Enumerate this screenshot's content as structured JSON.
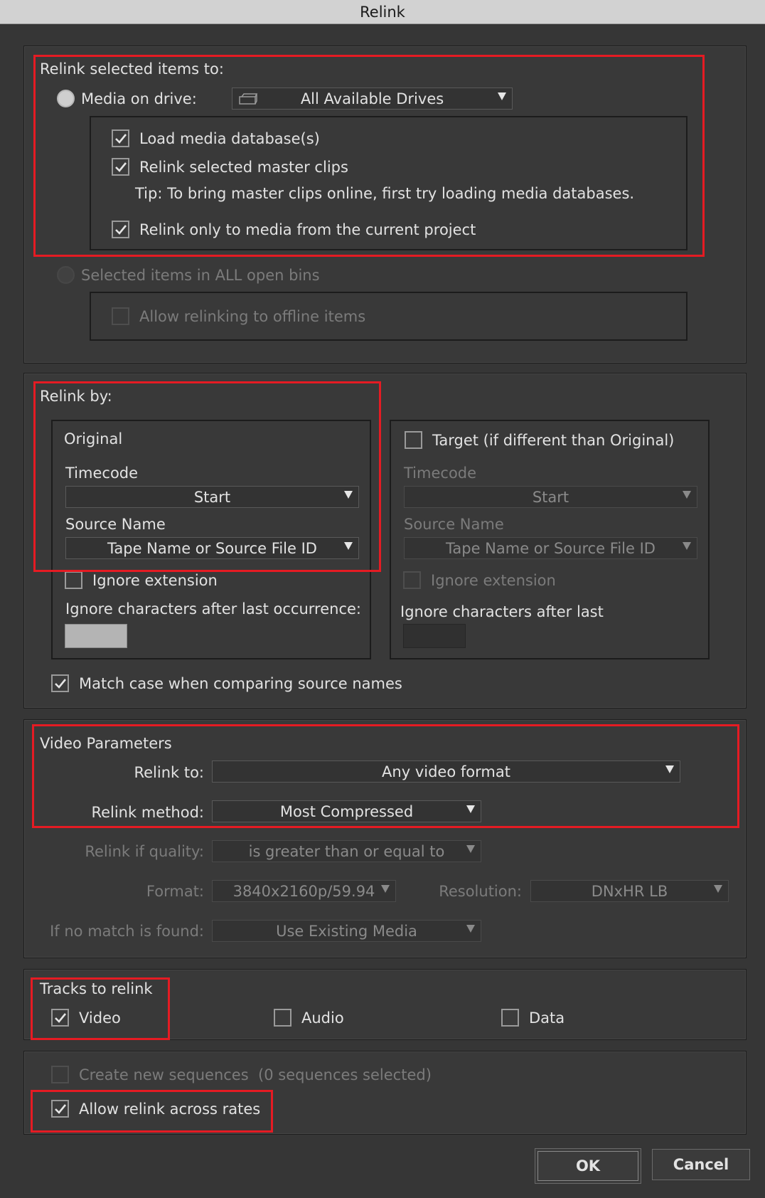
{
  "window": {
    "title": "Relink"
  },
  "relink_items": {
    "label": "Relink selected items to:",
    "media_on_drive_label": "Media on drive:",
    "drive_dropdown": {
      "value": "All Available Drives",
      "icon": "drive-icon"
    },
    "load_media_db": {
      "label": "Load media database(s)",
      "checked": true
    },
    "relink_master_clips": {
      "label": "Relink selected master clips",
      "checked": true
    },
    "tip": "Tip: To bring master clips online, first try loading media databases.",
    "relink_current_project": {
      "label": "Relink only to media from the current project",
      "checked": true
    },
    "all_open_bins_label": "Selected items in ALL open bins",
    "allow_offline": {
      "label": "Allow relinking to offline items",
      "checked": false
    }
  },
  "relink_by": {
    "label": "Relink by:",
    "original": {
      "title": "Original",
      "timecode_label": "Timecode",
      "timecode_value": "Start",
      "source_name_label": "Source Name",
      "source_name_value": "Tape Name or Source File ID",
      "ignore_extension": "Ignore extension",
      "ignore_chars_label": "Ignore characters after last occurrence:"
    },
    "target": {
      "title": "Target (if different than Original)",
      "timecode_label": "Timecode",
      "timecode_value": "Start",
      "source_name_label": "Source Name",
      "source_name_value": "Tape Name or Source File ID",
      "ignore_extension": "Ignore extension",
      "ignore_chars_label": "Ignore characters after last"
    },
    "match_case": {
      "label": "Match case when comparing source names",
      "checked": true
    }
  },
  "video_params": {
    "label": "Video Parameters",
    "relink_to_label": "Relink to:",
    "relink_to_value": "Any video format",
    "method_label": "Relink method:",
    "method_value": "Most Compressed",
    "quality_label": "Relink if quality:",
    "quality_value": "is greater than or equal to",
    "format_label": "Format:",
    "format_value": "3840x2160p/59.94",
    "resolution_label": "Resolution:",
    "resolution_value": "DNxHR LB",
    "no_match_label": "If no match is found:",
    "no_match_value": "Use Existing Media"
  },
  "tracks": {
    "label": "Tracks to relink",
    "video": {
      "label": "Video",
      "checked": true
    },
    "audio": {
      "label": "Audio",
      "checked": false
    },
    "data": {
      "label": "Data",
      "checked": false
    }
  },
  "sequences": {
    "create_new": "Create new sequences  (0 sequences selected)",
    "allow_across_rates": {
      "label": "Allow relink across rates",
      "checked": true
    }
  },
  "buttons": {
    "ok": "OK",
    "cancel": "Cancel"
  },
  "colors": {
    "highlight": "#e51b23",
    "background": "#363636",
    "titlebar": "#d2d2d2"
  }
}
